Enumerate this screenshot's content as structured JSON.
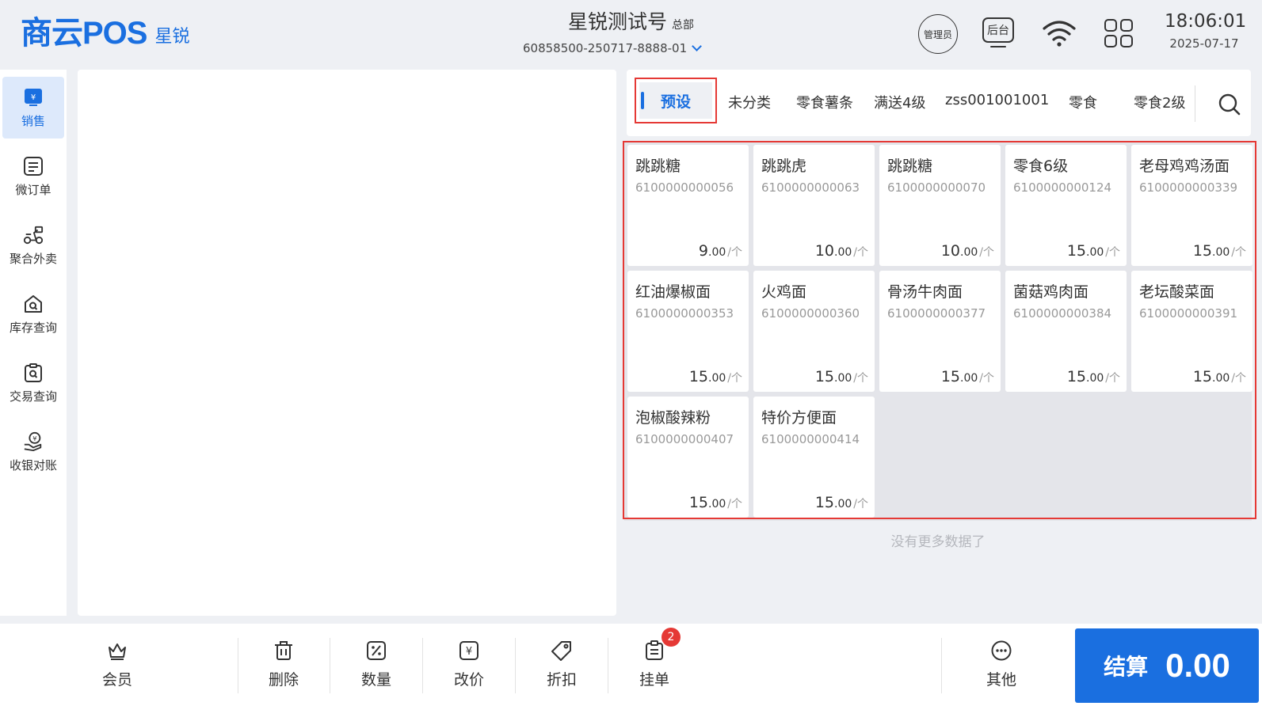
{
  "header": {
    "logo_main": "商云POS",
    "logo_sub": "星锐",
    "store_name": "星锐测试号",
    "store_tag": "总部",
    "store_code": "60858500-250717-8888-01",
    "admin_label": "管理员",
    "backend_label": "后台",
    "time": "18:06:01",
    "date": "2025-07-17",
    "icons": [
      "wifi-icon",
      "apps-grid-icon",
      "chevron-down-icon"
    ]
  },
  "sidebar": {
    "items": [
      {
        "label": "销售",
        "icon": "sales-icon",
        "active": true
      },
      {
        "label": "微订单",
        "icon": "micro-order-icon"
      },
      {
        "label": "聚合外卖",
        "icon": "delivery-icon"
      },
      {
        "label": "库存查询",
        "icon": "inventory-search-icon"
      },
      {
        "label": "交易查询",
        "icon": "transaction-search-icon"
      },
      {
        "label": "收银对账",
        "icon": "reconciliation-icon"
      }
    ]
  },
  "categories": {
    "active": "预设",
    "tabs": [
      "未分类",
      "零食薯条",
      "满送4级",
      "zss001001001",
      "零食",
      "零食2级"
    ],
    "search_icon": "search-icon"
  },
  "products": [
    {
      "name": "跳跳糖",
      "code": "6100000000056",
      "price_int": "9",
      "price_dec": ".00",
      "unit": "/个"
    },
    {
      "name": "跳跳虎",
      "code": "6100000000063",
      "price_int": "10",
      "price_dec": ".00",
      "unit": "/个"
    },
    {
      "name": "跳跳糖",
      "code": "6100000000070",
      "price_int": "10",
      "price_dec": ".00",
      "unit": "/个"
    },
    {
      "name": "零食6级",
      "code": "6100000000124",
      "price_int": "15",
      "price_dec": ".00",
      "unit": "/个"
    },
    {
      "name": "老母鸡鸡汤面",
      "code": "6100000000339",
      "price_int": "15",
      "price_dec": ".00",
      "unit": "/个"
    },
    {
      "name": "红油爆椒面",
      "code": "6100000000353",
      "price_int": "15",
      "price_dec": ".00",
      "unit": "/个"
    },
    {
      "name": "火鸡面",
      "code": "6100000000360",
      "price_int": "15",
      "price_dec": ".00",
      "unit": "/个"
    },
    {
      "name": "骨汤牛肉面",
      "code": "6100000000377",
      "price_int": "15",
      "price_dec": ".00",
      "unit": "/个"
    },
    {
      "name": "菌菇鸡肉面",
      "code": "6100000000384",
      "price_int": "15",
      "price_dec": ".00",
      "unit": "/个"
    },
    {
      "name": "老坛酸菜面",
      "code": "6100000000391",
      "price_int": "15",
      "price_dec": ".00",
      "unit": "/个"
    },
    {
      "name": "泡椒酸辣粉",
      "code": "6100000000407",
      "price_int": "15",
      "price_dec": ".00",
      "unit": "/个"
    },
    {
      "name": "特价方便面",
      "code": "6100000000414",
      "price_int": "15",
      "price_dec": ".00",
      "unit": "/个"
    }
  ],
  "no_more_text": "没有更多数据了",
  "toolbar": {
    "member": "会员",
    "delete": "删除",
    "quantity": "数量",
    "change_price": "改价",
    "discount": "折扣",
    "hold_order": "挂单",
    "hold_badge": "2",
    "other": "其他"
  },
  "checkout": {
    "label": "结算",
    "amount": "0.00"
  },
  "colors": {
    "accent": "#1a6fe0",
    "highlight_border": "#e53935",
    "background": "#eef0f4"
  }
}
